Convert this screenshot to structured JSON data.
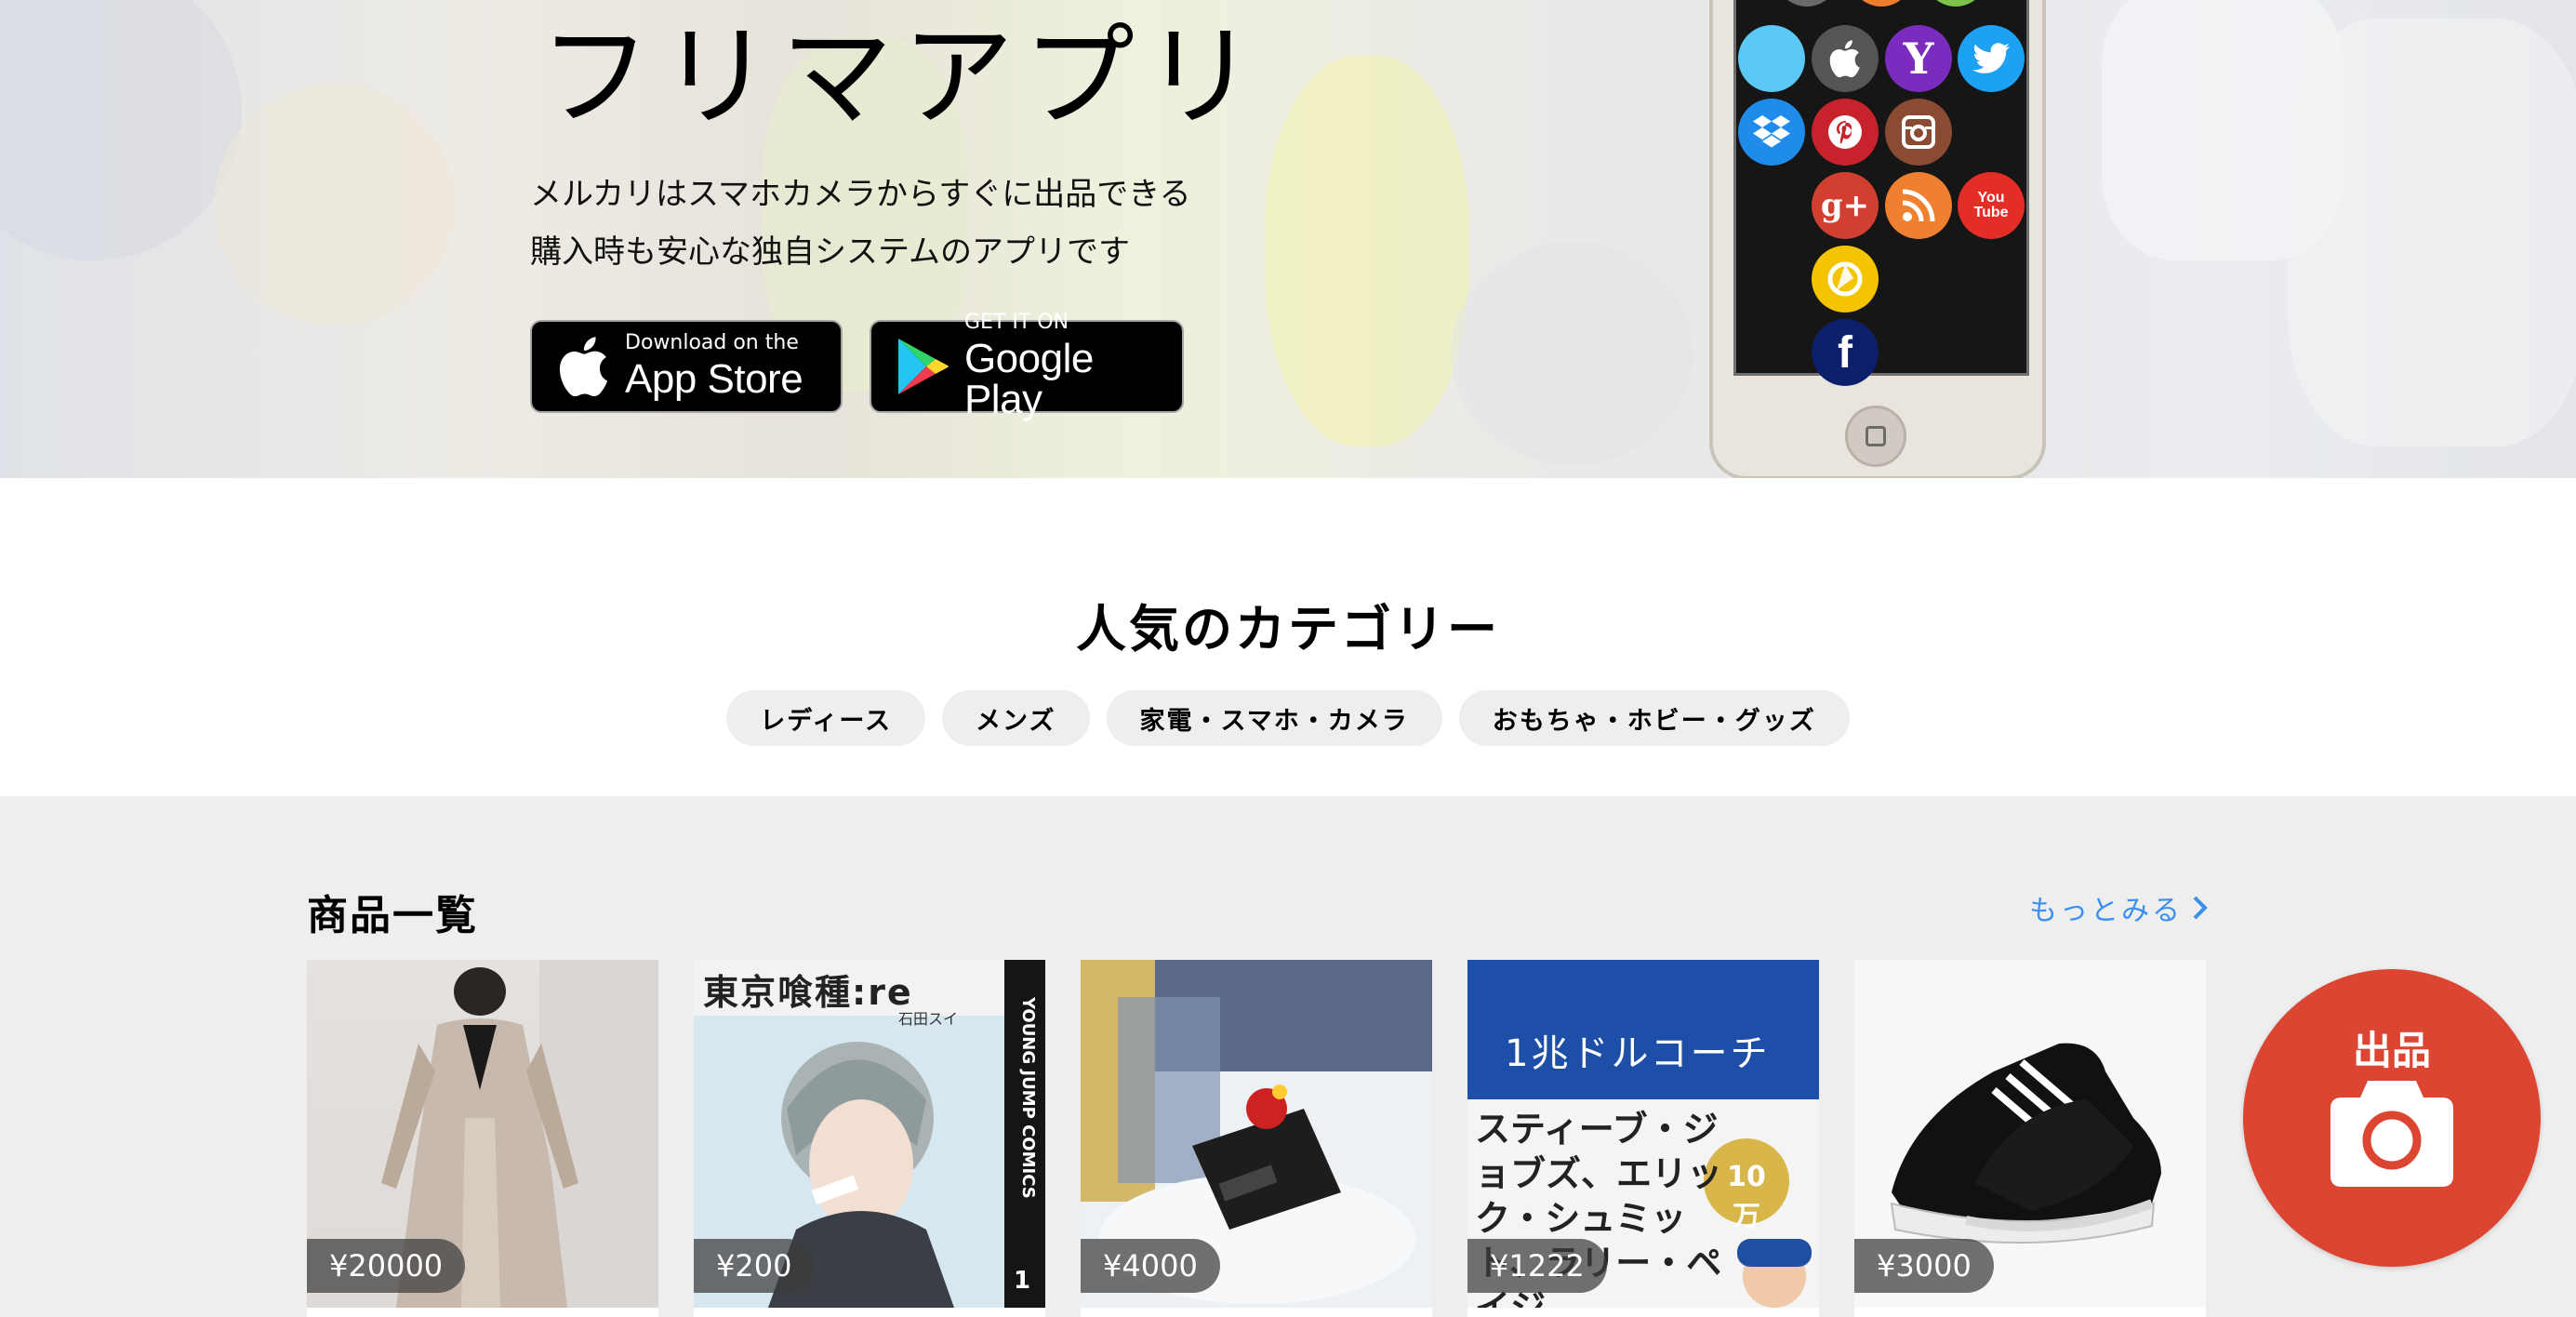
{
  "hero": {
    "title": "フリマアプリ",
    "description_line1": "メルカリはスマホカメラからすぐに出品できる",
    "description_line2": "購入時も安心な独自システムのアプリです",
    "app_store": {
      "small": "Download on the",
      "big": "App Store",
      "icon": "apple-icon"
    },
    "google_play": {
      "small": "GET IT ON",
      "big": "Google Play",
      "icon": "google-play-icon"
    }
  },
  "phone_apps": [
    {
      "name": "chat-app-icon",
      "color": "#5bc8f5",
      "glyph": ""
    },
    {
      "name": "apple-app-icon",
      "color": "#555555",
      "glyph": ""
    },
    {
      "name": "yahoo-app-icon",
      "color": "#7b2cbf",
      "glyph": "Y"
    },
    {
      "name": "twitter-app-icon",
      "color": "#1da1f2",
      "glyph": ""
    },
    {
      "name": "dropbox-app-icon",
      "color": "#1f8ceb",
      "glyph": ""
    },
    {
      "name": "pinterest-app-icon",
      "color": "#c8232c",
      "glyph": "P"
    },
    {
      "name": "instagram-app-icon",
      "color": "#8b4b32",
      "glyph": ""
    },
    {
      "name": "google-plus-app-icon",
      "color": "#d23f31",
      "glyph": "g+"
    },
    {
      "name": "rss-app-icon",
      "color": "#ee802f",
      "glyph": ""
    },
    {
      "name": "youtube-app-icon",
      "color": "#e52d27",
      "glyph": "You Tube"
    },
    {
      "name": "picasa-app-icon",
      "color": "#f5c400",
      "glyph": ""
    },
    {
      "name": "facebook-app-icon",
      "color": "#0b1f6b",
      "glyph": "f"
    }
  ],
  "categories": {
    "title": "人気のカテゴリー",
    "items": [
      "レディース",
      "メンズ",
      "家電・スマホ・カメラ",
      "おもちゃ・ホビー・グッズ"
    ]
  },
  "products": {
    "title": "商品一覧",
    "more_label": "もっとみる",
    "items": [
      {
        "price": "¥20000",
        "kind": "coat"
      },
      {
        "price": "¥200",
        "kind": "manga",
        "cover_title": "東京喰種:re",
        "cover_spine": "YOUNG JUMP COMICS",
        "cover_number": "1",
        "cover_author": "石田スイ"
      },
      {
        "price": "¥4000",
        "kind": "gadget"
      },
      {
        "price": "¥1222",
        "kind": "book",
        "cover_title": "1兆ドルコーチ",
        "cover_sub": "スティーブ・ジョブズ、エリック・シュミット、ラリー・ペイジ",
        "cover_badge": "10万"
      },
      {
        "price": "¥3000",
        "kind": "sneakers"
      }
    ]
  },
  "fab": {
    "label": "出品",
    "icon": "camera-icon",
    "color": "#dd4533"
  }
}
